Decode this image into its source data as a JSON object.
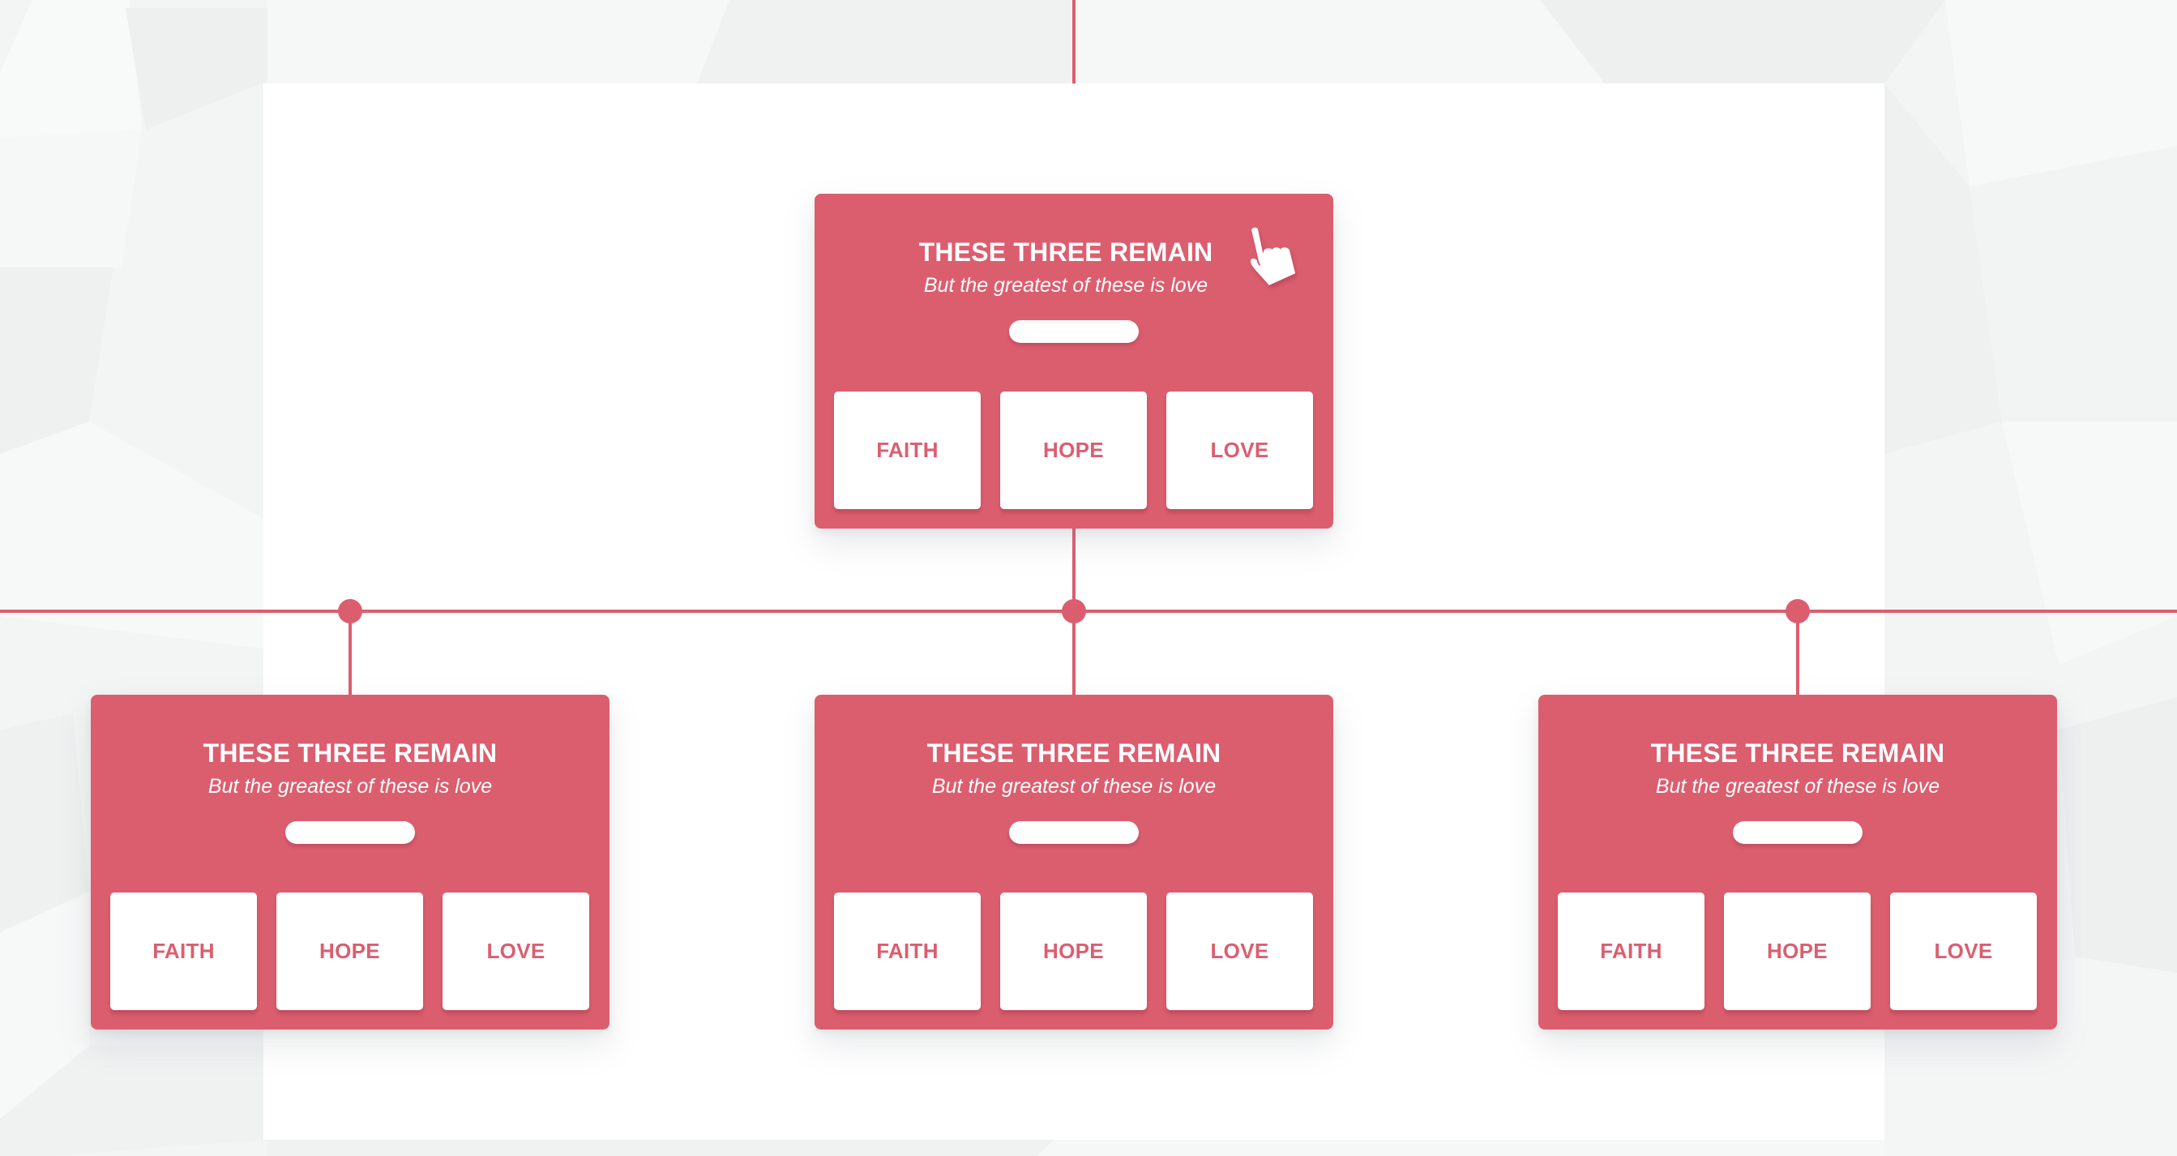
{
  "diagram": {
    "accent_color": "#db5e6f",
    "panel_color": "#ffffff",
    "background_color": "#f3f5f5",
    "root": {
      "title": "THESE THREE REMAIN",
      "subtitle": "But the greatest of these is love",
      "icon": "pointing-hand-icon",
      "items": [
        "FAITH",
        "HOPE",
        "LOVE"
      ]
    },
    "children": [
      {
        "title": "THESE THREE REMAIN",
        "subtitle": "But the greatest of these is love",
        "items": [
          "FAITH",
          "HOPE",
          "LOVE"
        ]
      },
      {
        "title": "THESE THREE REMAIN",
        "subtitle": "But the greatest of these is love",
        "items": [
          "FAITH",
          "HOPE",
          "LOVE"
        ]
      },
      {
        "title": "THESE THREE REMAIN",
        "subtitle": "But the greatest of these is love",
        "items": [
          "FAITH",
          "HOPE",
          "LOVE"
        ]
      }
    ]
  }
}
